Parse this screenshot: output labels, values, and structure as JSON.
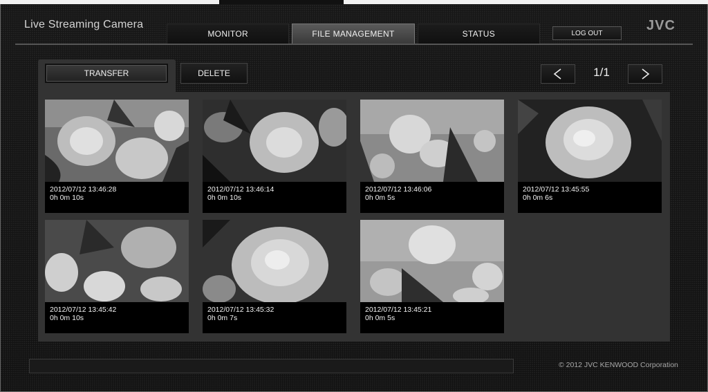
{
  "header": {
    "app_title": "Live Streaming Camera",
    "logo_text": "JVC",
    "tabs": [
      {
        "label": "MONITOR",
        "active": false
      },
      {
        "label": "FILE MANAGEMENT",
        "active": true
      },
      {
        "label": "STATUS",
        "active": false
      }
    ],
    "logout_label": "LOG OUT"
  },
  "toolbar": {
    "transfer_label": "TRANSFER",
    "delete_label": "DELETE",
    "prev_icon": "chevron-left-icon",
    "next_icon": "chevron-right-icon",
    "page_indicator": "1/1"
  },
  "clips": [
    {
      "timestamp": "2012/07/12 13:46:28",
      "duration": "0h 0m 10s"
    },
    {
      "timestamp": "2012/07/12 13:46:14",
      "duration": "0h 0m 10s"
    },
    {
      "timestamp": "2012/07/12 13:46:06",
      "duration": "0h 0m 5s"
    },
    {
      "timestamp": "2012/07/12 13:45:55",
      "duration": "0h 0m 6s"
    },
    {
      "timestamp": "2012/07/12 13:45:42",
      "duration": "0h 0m 10s"
    },
    {
      "timestamp": "2012/07/12 13:45:32",
      "duration": "0h 0m 7s"
    },
    {
      "timestamp": "2012/07/12 13:45:21",
      "duration": "0h 0m 5s"
    }
  ],
  "footer": {
    "copyright": "© 2012 JVC KENWOOD Corporation"
  },
  "colors": {
    "background": "#121212",
    "panel": "#333333",
    "active_tab": "#4a4a4a",
    "text": "#f0f0f0"
  }
}
